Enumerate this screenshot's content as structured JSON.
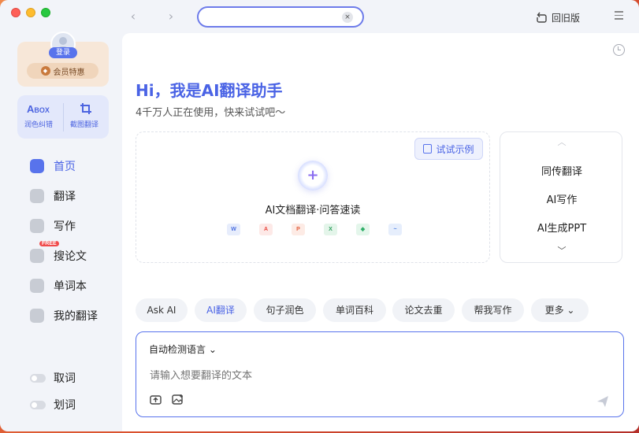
{
  "window": {
    "search": {
      "value": "",
      "clear_glyph": "×"
    },
    "old_version_label": "回旧版"
  },
  "sidebar": {
    "login_label": "登录",
    "vip_label": "会员特惠",
    "tools": {
      "brand": "A",
      "brand_small": "BOX",
      "polish_label": "润色纠错",
      "screenshot_label": "截图翻译"
    },
    "nav": [
      {
        "label": "首页",
        "icon": "home-icon",
        "active": true
      },
      {
        "label": "翻译",
        "icon": "translate-icon",
        "active": false
      },
      {
        "label": "写作",
        "icon": "pen-icon",
        "active": false
      },
      {
        "label": "搜论文",
        "icon": "graduation-cap-icon",
        "active": false,
        "badge": "FREE"
      },
      {
        "label": "单词本",
        "icon": "wordbook-icon",
        "active": false
      },
      {
        "label": "我的翻译",
        "icon": "document-icon",
        "active": false
      }
    ],
    "toggles": [
      {
        "label": "取词",
        "on": false
      },
      {
        "label": "划词",
        "on": false
      }
    ]
  },
  "main": {
    "greeting": "Hi，我是AI翻译助手",
    "subgreeting": "4千万人正在使用，快来试试吧～",
    "example_button": "试试示例",
    "doc_label": "AI文档翻译·问答速读",
    "filetypes": [
      {
        "glyph": "W",
        "name": "word-icon",
        "color": "#4a6ee0",
        "bg": "#e7edfc"
      },
      {
        "glyph": "A",
        "name": "pdf-icon",
        "color": "#e8453c",
        "bg": "#fde9e7"
      },
      {
        "glyph": "P",
        "name": "ppt-icon",
        "color": "#e25b3a",
        "bg": "#fdebe5"
      },
      {
        "glyph": "X",
        "name": "excel-icon",
        "color": "#2d9d5c",
        "bg": "#e4f5ea"
      },
      {
        "glyph": "◆",
        "name": "epub-icon",
        "color": "#2fae68",
        "bg": "#e4f6eb"
      },
      {
        "glyph": "~",
        "name": "image-icon",
        "color": "#4a7de0",
        "bg": "#e6eefc"
      }
    ],
    "side_menu": [
      "同传翻译",
      "AI写作",
      "AI生成PPT"
    ],
    "chips": [
      {
        "label": "Ask AI",
        "active": false
      },
      {
        "label": "AI翻译",
        "active": true
      },
      {
        "label": "句子润色",
        "active": false
      },
      {
        "label": "单词百科",
        "active": false
      },
      {
        "label": "论文去重",
        "active": false
      },
      {
        "label": "帮我写作",
        "active": false
      },
      {
        "label": "更多 ⌄",
        "active": false
      }
    ],
    "input": {
      "language_label": "自动检测语言 ⌄",
      "placeholder": "请输入想要翻译的文本"
    }
  },
  "colors": {
    "accent": "#4a63e5",
    "sidebar_bg": "#f2f4f9",
    "vip_bg": "#f7e7d8"
  }
}
